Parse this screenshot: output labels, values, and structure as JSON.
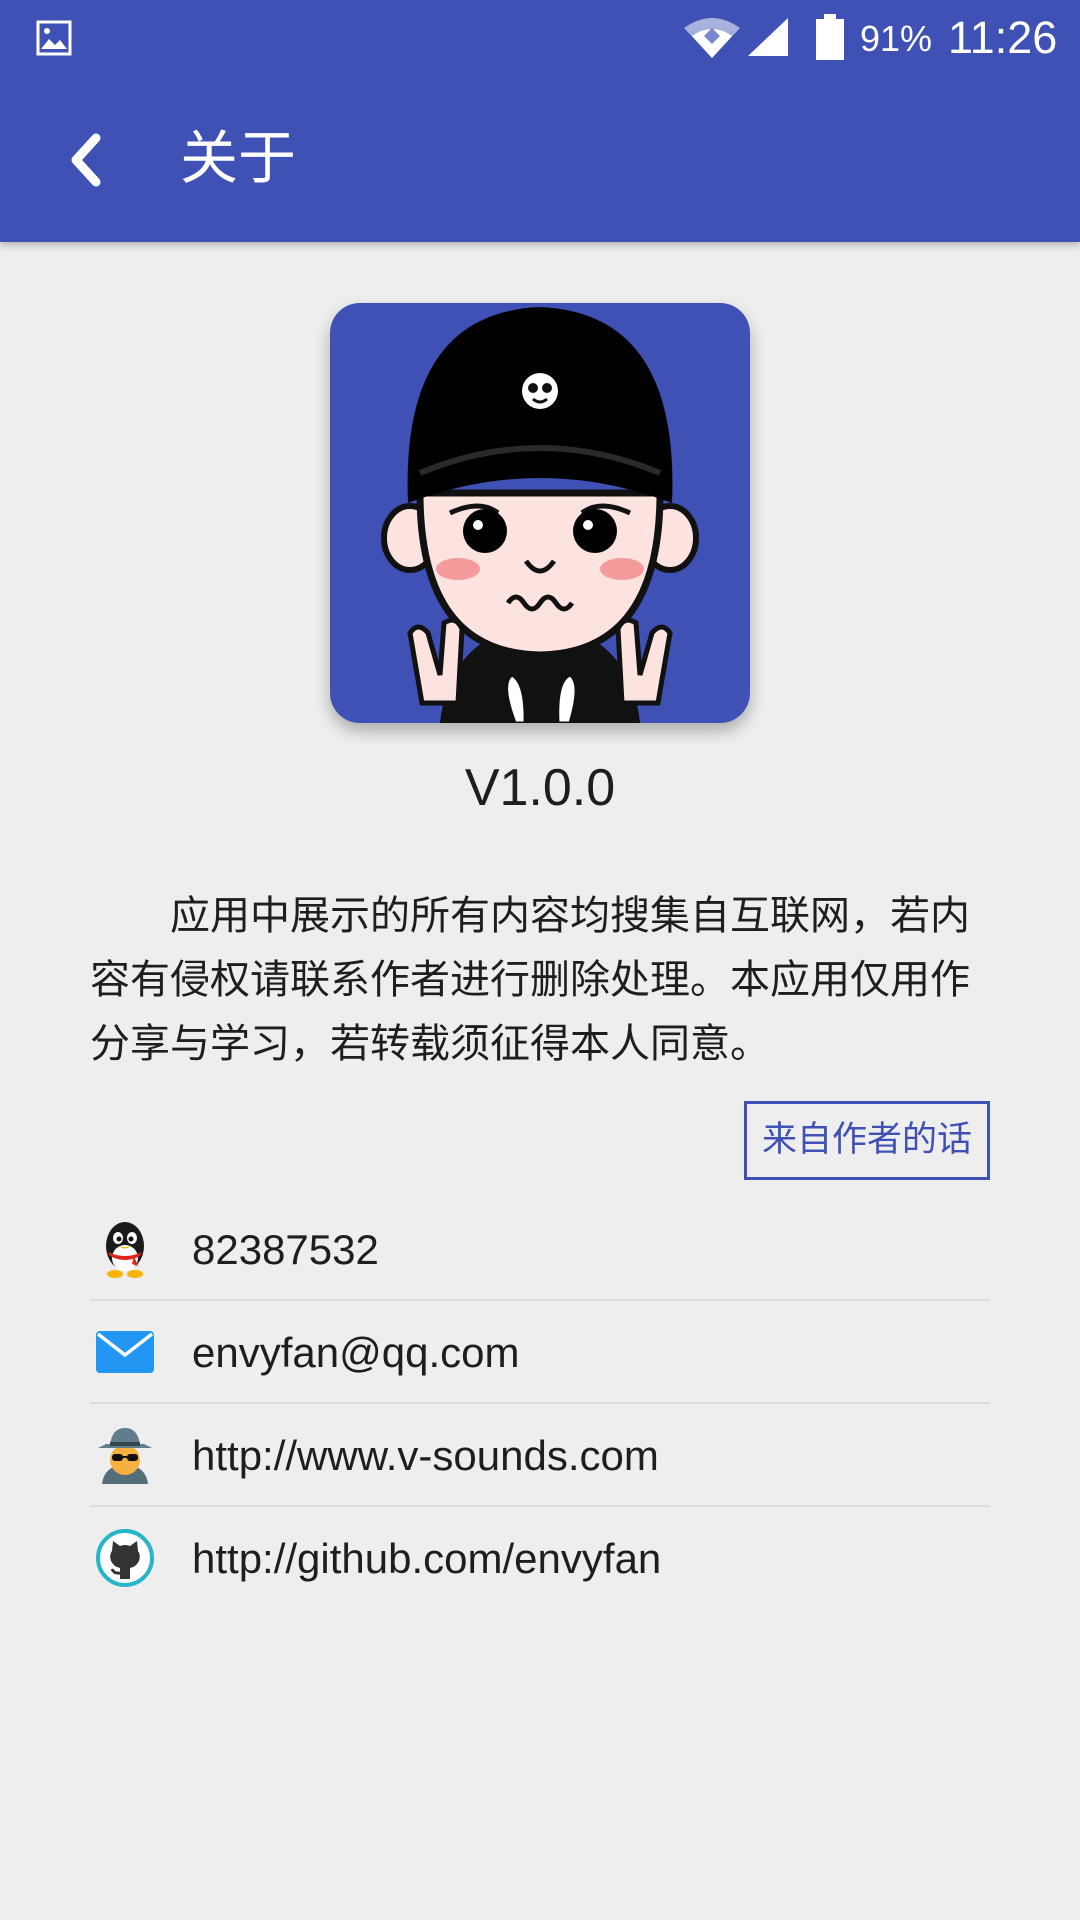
{
  "status_bar": {
    "battery_percent": "91%",
    "time": "11:26",
    "icons": [
      "gallery-icon",
      "wifi-icon",
      "signal-icon",
      "battery-icon"
    ]
  },
  "toolbar": {
    "title": "关于",
    "back_icon": "back-arrow-icon",
    "background": "#3f51b5"
  },
  "app": {
    "avatar_icon": "cartoon-avatar-icon",
    "version": "V1.0.0",
    "description": "应用中展示的所有内容均搜集自互联网，若内容有侵权请联系作者进行删除处理。本应用仅用作分享与学习，若转载须征得本人同意。",
    "author_button": "来自作者的话"
  },
  "contacts": [
    {
      "icon": "qq-penguin-icon",
      "text": "82387532"
    },
    {
      "icon": "email-icon",
      "text": "envyfan@qq.com"
    },
    {
      "icon": "spy-icon",
      "text": "http://www.v-sounds.com"
    },
    {
      "icon": "github-icon",
      "text": "http://github.com/envyfan"
    }
  ],
  "colors": {
    "primary": "#3f51b5",
    "background": "#eeeeee",
    "divider": "#dcdcdc"
  }
}
